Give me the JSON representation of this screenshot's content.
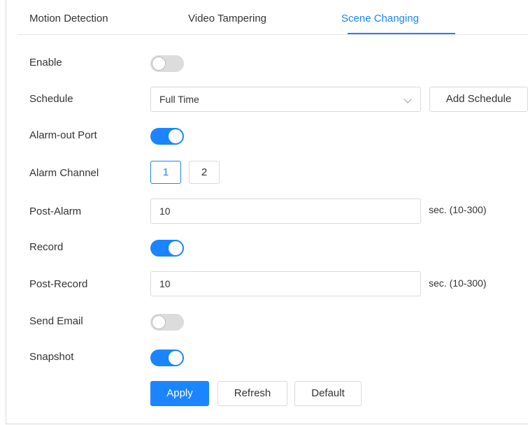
{
  "tabs": {
    "motion_detection": "Motion Detection",
    "video_tampering": "Video Tampering",
    "scene_changing": "Scene Changing",
    "active": "Scene Changing"
  },
  "form": {
    "enable": {
      "label": "Enable",
      "on": false
    },
    "schedule": {
      "label": "Schedule",
      "value": "Full Time",
      "add_label": "Add Schedule"
    },
    "alarm_out_port": {
      "label": "Alarm-out Port",
      "on": true
    },
    "alarm_channel": {
      "label": "Alarm Channel",
      "channels": [
        "1",
        "2"
      ],
      "selected": "1"
    },
    "post_alarm": {
      "label": "Post-Alarm",
      "value": "10",
      "unit": "sec. (10-300)"
    },
    "record": {
      "label": "Record",
      "on": true
    },
    "post_record": {
      "label": "Post-Record",
      "value": "10",
      "unit": "sec. (10-300)"
    },
    "send_email": {
      "label": "Send Email",
      "on": false
    },
    "snapshot": {
      "label": "Snapshot",
      "on": true
    }
  },
  "actions": {
    "apply": "Apply",
    "refresh": "Refresh",
    "default": "Default"
  },
  "colors": {
    "accent": "#1a85ff",
    "toggle_off": "#dcdcdc",
    "border": "#d9d9d9",
    "text": "#333333"
  }
}
